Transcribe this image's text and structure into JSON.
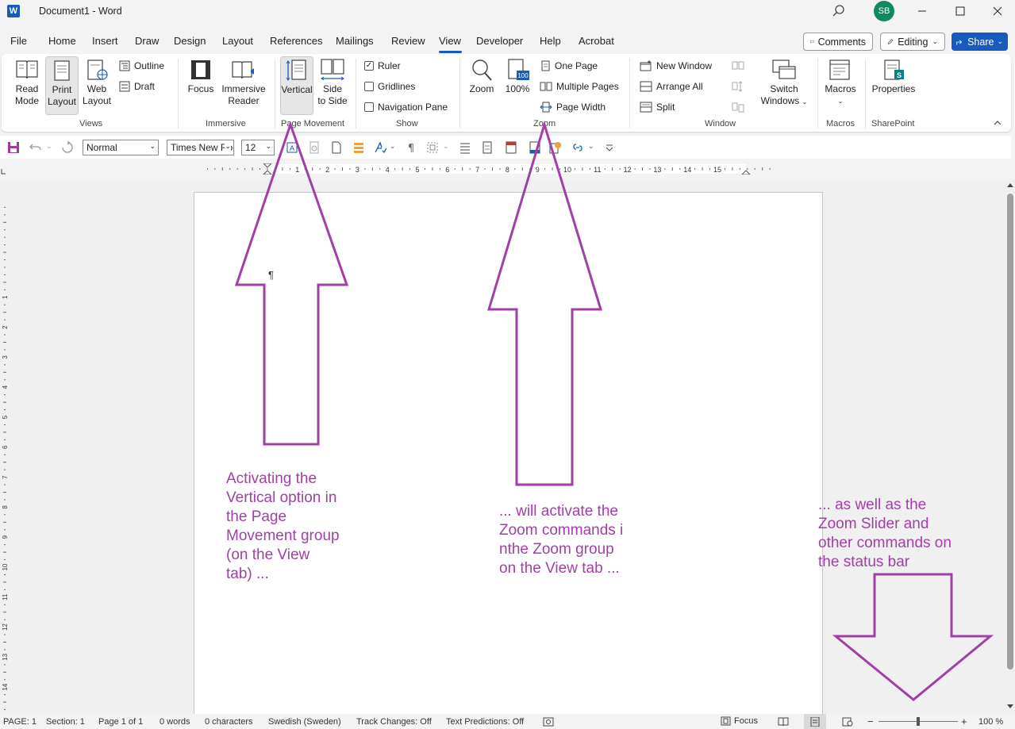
{
  "titlebar": {
    "logo": "W",
    "title": "Document1  -  Word",
    "avatar": "SB"
  },
  "tabs": [
    "File",
    "Home",
    "Insert",
    "Draw",
    "Design",
    "Layout",
    "References",
    "Mailings",
    "Review",
    "View",
    "Developer",
    "Help",
    "Acrobat"
  ],
  "active_tab": "View",
  "top_buttons": {
    "comments": "Comments",
    "editing": "Editing",
    "share": "Share"
  },
  "ribbon": {
    "views": {
      "label": "Views",
      "read_mode": [
        "Read",
        "Mode"
      ],
      "print_layout": [
        "Print",
        "Layout"
      ],
      "web_layout": [
        "Web",
        "Layout"
      ],
      "outline": "Outline",
      "draft": "Draft"
    },
    "immersive": {
      "label": "Immersive",
      "focus": "Focus",
      "immersive_reader": [
        "Immersive",
        "Reader"
      ]
    },
    "page_movement": {
      "label": "Page Movement",
      "vertical": "Vertical",
      "side_to_side": [
        "Side",
        "to Side"
      ]
    },
    "show": {
      "label": "Show",
      "ruler": "Ruler",
      "gridlines": "Gridlines",
      "navigation_pane": "Navigation Pane"
    },
    "zoom": {
      "label": "Zoom",
      "zoom": "Zoom",
      "hundred": "100%",
      "icon_badge": "100",
      "one_page": "One Page",
      "multiple_pages": "Multiple Pages",
      "page_width": "Page Width"
    },
    "window": {
      "label": "Window",
      "new_window": "New Window",
      "arrange_all": "Arrange All",
      "split": "Split",
      "switch_windows": [
        "Switch",
        "Windows"
      ]
    },
    "macros": {
      "label": "Macros",
      "macros": "Macros"
    },
    "sharepoint": {
      "label": "SharePoint",
      "properties": "Properties",
      "icon_badge": "S"
    }
  },
  "qat": {
    "style": "Normal",
    "font": "Times New Ro",
    "size": "12"
  },
  "ruler_numbers": [
    "1",
    "2",
    "3",
    "4",
    "5",
    "6",
    "7",
    "8",
    "9",
    "10",
    "11",
    "12",
    "13",
    "14",
    "15"
  ],
  "vruler_numbers": [
    "1",
    "2",
    "3",
    "4",
    "5",
    "6",
    "7",
    "8",
    "9",
    "10",
    "11",
    "12",
    "13",
    "14"
  ],
  "annotations": {
    "left": [
      "Activating the",
      "Vertical option in",
      "the Page",
      "Movement group",
      "(on the View",
      "tab) ..."
    ],
    "middle": [
      "... will activate the",
      "Zoom commands i",
      "nthe Zoom group",
      "on the View tab ..."
    ],
    "right": [
      "... as well as the",
      "Zoom Slider and",
      "other commands on",
      "the status bar"
    ]
  },
  "statusbar": {
    "page": "PAGE: 1",
    "section": "Section: 1",
    "page_of": "Page 1 of 1",
    "words": "0 words",
    "characters": "0 characters",
    "language": "Swedish (Sweden)",
    "track_changes": "Track Changes: Off",
    "text_predictions": "Text Predictions: Off",
    "focus": "Focus",
    "zoom_minus": "−",
    "zoom_plus": "+",
    "zoom_level": "100 %"
  },
  "colors": {
    "accent": "#185abd",
    "annotation": "#a040a6"
  }
}
